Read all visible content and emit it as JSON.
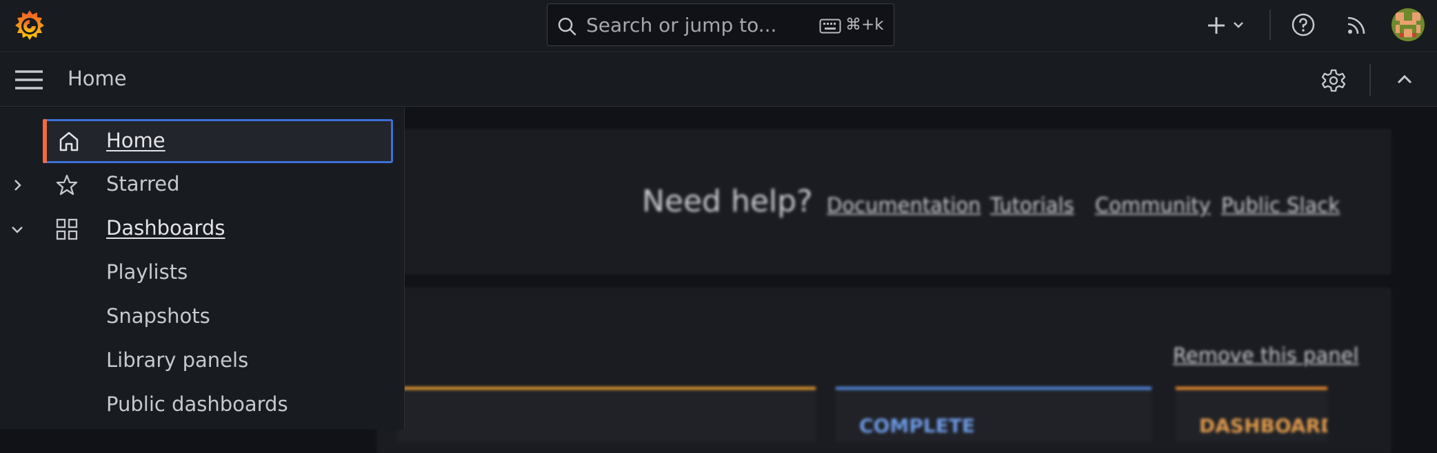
{
  "search": {
    "placeholder": "Search or jump to...",
    "shortcut": "⌘+k"
  },
  "breadcrumb": {
    "current": "Home"
  },
  "background": {
    "need_help": "Need help?",
    "links": [
      "Documentation",
      "Tutorials",
      "Community",
      "Public Slack"
    ],
    "remove_panel": "Remove this panel",
    "cards": [
      {
        "title": "COMPLETE",
        "color": "#5794f2"
      },
      {
        "title": "DASHBOARDS",
        "color": "#ff9830"
      }
    ]
  },
  "sidebar": {
    "items": [
      {
        "label": "Home",
        "icon": "home-icon",
        "active": true
      },
      {
        "label": "Starred",
        "icon": "star-icon",
        "expand": "collapsed"
      },
      {
        "label": "Dashboards",
        "icon": "apps-icon",
        "expand": "expanded"
      },
      {
        "label": "Playlists"
      },
      {
        "label": "Snapshots"
      },
      {
        "label": "Library panels"
      },
      {
        "label": "Public dashboards"
      }
    ]
  },
  "colors": {
    "accent": "#3d71d9",
    "active_bar": "#f46b3b",
    "brand": "#f46800"
  }
}
